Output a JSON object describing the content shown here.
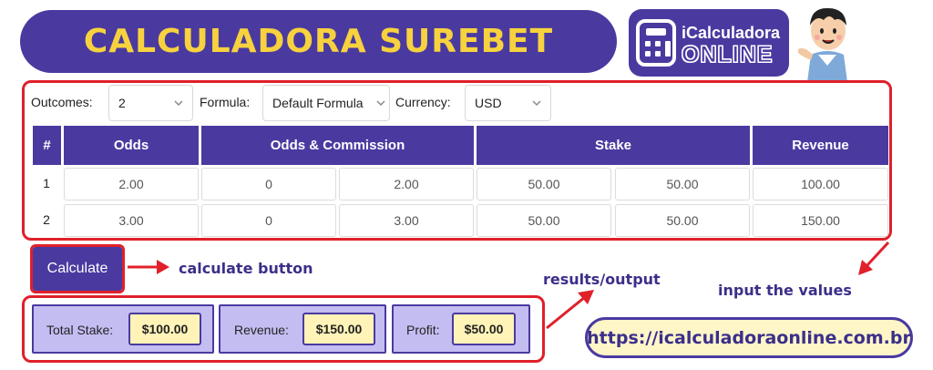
{
  "header": {
    "title": "CALCULADORA SUREBET",
    "logo_top": "iCalculadora",
    "logo_bottom": "ONLINE"
  },
  "controls": {
    "outcomes_label": "Outcomes:",
    "outcomes_value": "2",
    "formula_label": "Formula:",
    "formula_value": "Default Formula",
    "currency_label": "Currency:",
    "currency_value": "USD"
  },
  "table": {
    "headers": [
      "#",
      "Odds",
      "Odds & Commission",
      "Stake",
      "Revenue"
    ],
    "rows": [
      {
        "num": "1",
        "odds": "2.00",
        "commission": "0",
        "odds_commission": "2.00",
        "stake_a": "50.00",
        "stake_b": "50.00",
        "revenue": "100.00"
      },
      {
        "num": "2",
        "odds": "3.00",
        "commission": "0",
        "odds_commission": "3.00",
        "stake_a": "50.00",
        "stake_b": "50.00",
        "revenue": "150.00"
      }
    ]
  },
  "calculate_label": "Calculate",
  "annotations": {
    "calculate": "calculate button",
    "results": "results/output",
    "input": "input the  values"
  },
  "results": {
    "total_stake_label": "Total Stake:",
    "total_stake_value": "$100.00",
    "revenue_label": "Revenue:",
    "revenue_value": "$150.00",
    "profit_label": "Profit:",
    "profit_value": "$50.00"
  },
  "url": "https://icalculadoraonline.com.br",
  "colors": {
    "brand_purple": "#4a3aa0",
    "title_yellow": "#f7d23e",
    "highlight_red": "#e0202a",
    "result_bg": "#c4bdf2",
    "value_bg": "#fff3b8"
  }
}
